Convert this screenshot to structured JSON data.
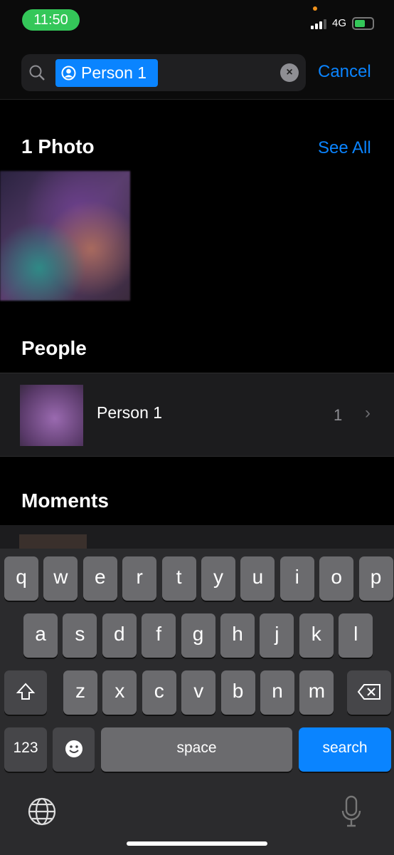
{
  "status": {
    "time": "11:50",
    "network": "4G",
    "battery_charging": true
  },
  "search": {
    "token": "Person 1",
    "token_icon": "person-circle-icon",
    "cancel": "Cancel"
  },
  "photos": {
    "title": "1 Photo",
    "see_all": "See All"
  },
  "people": {
    "title": "People",
    "items": [
      {
        "name": "Person 1",
        "count": "1"
      }
    ]
  },
  "moments": {
    "title": "Moments"
  },
  "keyboard": {
    "row1": [
      "q",
      "w",
      "e",
      "r",
      "t",
      "y",
      "u",
      "i",
      "o",
      "p"
    ],
    "row2": [
      "a",
      "s",
      "d",
      "f",
      "g",
      "h",
      "j",
      "k",
      "l"
    ],
    "row3": [
      "z",
      "x",
      "c",
      "v",
      "b",
      "n",
      "m"
    ],
    "numbers": "123",
    "space": "space",
    "search": "search"
  },
  "colors": {
    "accent": "#0a84ff",
    "time_pill": "#34c759"
  }
}
